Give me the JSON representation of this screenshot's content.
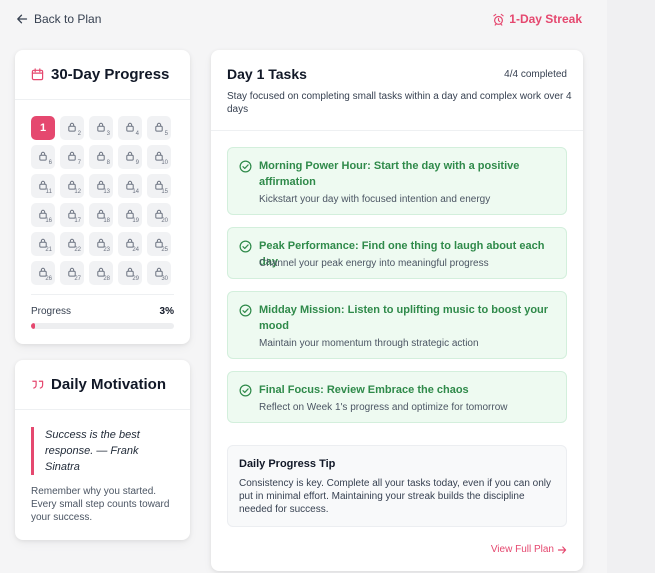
{
  "nav": {
    "back_label": "Back to Plan",
    "streak_label": "1-Day Streak"
  },
  "colors": {
    "accent": "#e5486f",
    "success": "#2f8a4a",
    "success_bg": "#eefaf1"
  },
  "progress_card": {
    "title": "30-Day Progress",
    "active_day": "1",
    "locked_days": [
      "2",
      "3",
      "4",
      "5",
      "6",
      "7",
      "8",
      "9",
      "10",
      "11",
      "12",
      "13",
      "14",
      "15",
      "16",
      "17",
      "18",
      "19",
      "20",
      "21",
      "22",
      "23",
      "24",
      "25",
      "26",
      "27",
      "28",
      "29",
      "30"
    ],
    "progress_label": "Progress",
    "progress_value": "3%",
    "progress_fraction": 0.03
  },
  "motivation_card": {
    "title": "Daily Motivation",
    "quote": "Success is the best response. — Frank Sinatra",
    "note": "Remember why you started. Every small step counts toward your success."
  },
  "tasks_card": {
    "title": "Day 1 Tasks",
    "count": "4/4 completed",
    "subtitle": "Stay focused on completing small tasks within a day and complex work over 4 days",
    "tasks": [
      {
        "title": "Morning Power Hour: Start the day with a positive affirmation",
        "desc": "Kickstart your day with focused intention and energy"
      },
      {
        "title": "Peak Performance: Find one thing to laugh about each day",
        "desc": "Channel your peak energy into meaningful progress"
      },
      {
        "title": "Midday Mission: Listen to uplifting music to boost your mood",
        "desc": "Maintain your momentum through strategic action"
      },
      {
        "title": "Final Focus: Review Embrace the chaos",
        "desc": "Reflect on Week 1's progress and optimize for tomorrow"
      }
    ],
    "tip_title": "Daily Progress Tip",
    "tip_text": "Consistency is key. Complete all your tasks today, even if you can only put in minimal effort. Maintaining your streak builds the discipline needed for success.",
    "view_plan_label": "View Full Plan"
  }
}
